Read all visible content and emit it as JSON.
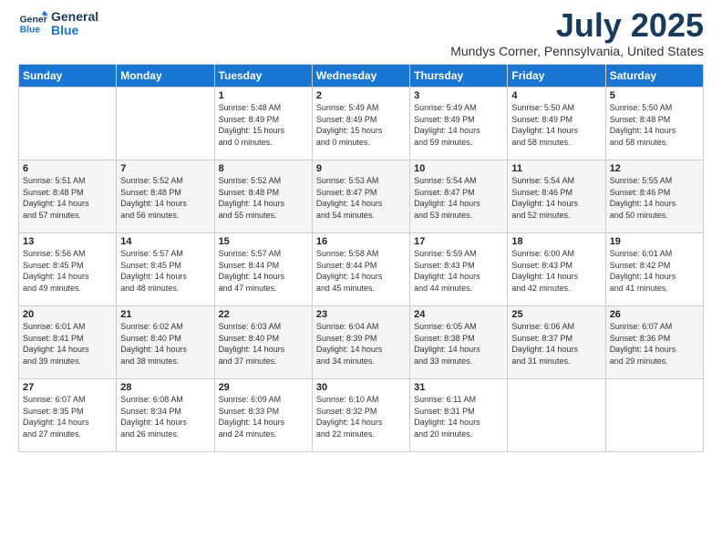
{
  "logo": {
    "line1": "General",
    "line2": "Blue"
  },
  "title": "July 2025",
  "location": "Mundys Corner, Pennsylvania, United States",
  "weekdays": [
    "Sunday",
    "Monday",
    "Tuesday",
    "Wednesday",
    "Thursday",
    "Friday",
    "Saturday"
  ],
  "weeks": [
    [
      {
        "day": "",
        "info": ""
      },
      {
        "day": "",
        "info": ""
      },
      {
        "day": "1",
        "info": "Sunrise: 5:48 AM\nSunset: 8:49 PM\nDaylight: 15 hours\nand 0 minutes."
      },
      {
        "day": "2",
        "info": "Sunrise: 5:49 AM\nSunset: 8:49 PM\nDaylight: 15 hours\nand 0 minutes."
      },
      {
        "day": "3",
        "info": "Sunrise: 5:49 AM\nSunset: 8:49 PM\nDaylight: 14 hours\nand 59 minutes."
      },
      {
        "day": "4",
        "info": "Sunrise: 5:50 AM\nSunset: 8:49 PM\nDaylight: 14 hours\nand 58 minutes."
      },
      {
        "day": "5",
        "info": "Sunrise: 5:50 AM\nSunset: 8:48 PM\nDaylight: 14 hours\nand 58 minutes."
      }
    ],
    [
      {
        "day": "6",
        "info": "Sunrise: 5:51 AM\nSunset: 8:48 PM\nDaylight: 14 hours\nand 57 minutes."
      },
      {
        "day": "7",
        "info": "Sunrise: 5:52 AM\nSunset: 8:48 PM\nDaylight: 14 hours\nand 56 minutes."
      },
      {
        "day": "8",
        "info": "Sunrise: 5:52 AM\nSunset: 8:48 PM\nDaylight: 14 hours\nand 55 minutes."
      },
      {
        "day": "9",
        "info": "Sunrise: 5:53 AM\nSunset: 8:47 PM\nDaylight: 14 hours\nand 54 minutes."
      },
      {
        "day": "10",
        "info": "Sunrise: 5:54 AM\nSunset: 8:47 PM\nDaylight: 14 hours\nand 53 minutes."
      },
      {
        "day": "11",
        "info": "Sunrise: 5:54 AM\nSunset: 8:46 PM\nDaylight: 14 hours\nand 52 minutes."
      },
      {
        "day": "12",
        "info": "Sunrise: 5:55 AM\nSunset: 8:46 PM\nDaylight: 14 hours\nand 50 minutes."
      }
    ],
    [
      {
        "day": "13",
        "info": "Sunrise: 5:56 AM\nSunset: 8:45 PM\nDaylight: 14 hours\nand 49 minutes."
      },
      {
        "day": "14",
        "info": "Sunrise: 5:57 AM\nSunset: 8:45 PM\nDaylight: 14 hours\nand 48 minutes."
      },
      {
        "day": "15",
        "info": "Sunrise: 5:57 AM\nSunset: 8:44 PM\nDaylight: 14 hours\nand 47 minutes."
      },
      {
        "day": "16",
        "info": "Sunrise: 5:58 AM\nSunset: 8:44 PM\nDaylight: 14 hours\nand 45 minutes."
      },
      {
        "day": "17",
        "info": "Sunrise: 5:59 AM\nSunset: 8:43 PM\nDaylight: 14 hours\nand 44 minutes."
      },
      {
        "day": "18",
        "info": "Sunrise: 6:00 AM\nSunset: 8:43 PM\nDaylight: 14 hours\nand 42 minutes."
      },
      {
        "day": "19",
        "info": "Sunrise: 6:01 AM\nSunset: 8:42 PM\nDaylight: 14 hours\nand 41 minutes."
      }
    ],
    [
      {
        "day": "20",
        "info": "Sunrise: 6:01 AM\nSunset: 8:41 PM\nDaylight: 14 hours\nand 39 minutes."
      },
      {
        "day": "21",
        "info": "Sunrise: 6:02 AM\nSunset: 8:40 PM\nDaylight: 14 hours\nand 38 minutes."
      },
      {
        "day": "22",
        "info": "Sunrise: 6:03 AM\nSunset: 8:40 PM\nDaylight: 14 hours\nand 37 minutes."
      },
      {
        "day": "23",
        "info": "Sunrise: 6:04 AM\nSunset: 8:39 PM\nDaylight: 14 hours\nand 34 minutes."
      },
      {
        "day": "24",
        "info": "Sunrise: 6:05 AM\nSunset: 8:38 PM\nDaylight: 14 hours\nand 33 minutes."
      },
      {
        "day": "25",
        "info": "Sunrise: 6:06 AM\nSunset: 8:37 PM\nDaylight: 14 hours\nand 31 minutes."
      },
      {
        "day": "26",
        "info": "Sunrise: 6:07 AM\nSunset: 8:36 PM\nDaylight: 14 hours\nand 29 minutes."
      }
    ],
    [
      {
        "day": "27",
        "info": "Sunrise: 6:07 AM\nSunset: 8:35 PM\nDaylight: 14 hours\nand 27 minutes."
      },
      {
        "day": "28",
        "info": "Sunrise: 6:08 AM\nSunset: 8:34 PM\nDaylight: 14 hours\nand 26 minutes."
      },
      {
        "day": "29",
        "info": "Sunrise: 6:09 AM\nSunset: 8:33 PM\nDaylight: 14 hours\nand 24 minutes."
      },
      {
        "day": "30",
        "info": "Sunrise: 6:10 AM\nSunset: 8:32 PM\nDaylight: 14 hours\nand 22 minutes."
      },
      {
        "day": "31",
        "info": "Sunrise: 6:11 AM\nSunset: 8:31 PM\nDaylight: 14 hours\nand 20 minutes."
      },
      {
        "day": "",
        "info": ""
      },
      {
        "day": "",
        "info": ""
      }
    ]
  ]
}
